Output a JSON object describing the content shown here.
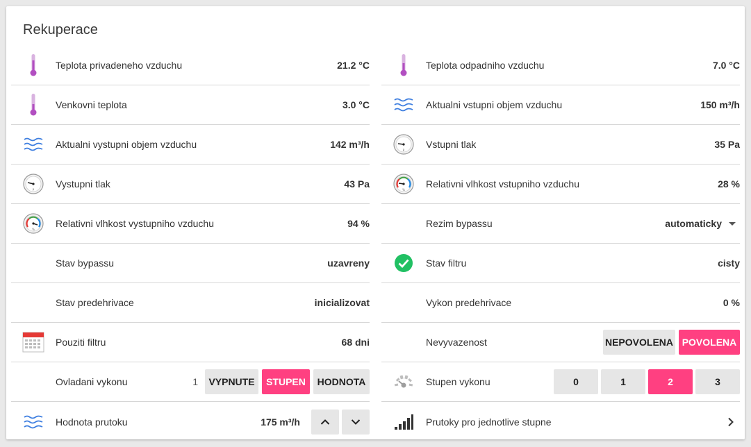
{
  "card": {
    "title": "Rekuperace"
  },
  "left": {
    "rows": [
      {
        "label": "Teplota privadeneho vzduchu",
        "value": "21.2 °C",
        "icon": "thermometer-icon"
      },
      {
        "label": "Venkovni teplota",
        "value": "3.0 °C",
        "icon": "thermometer-icon"
      },
      {
        "label": "Aktualni vystupni objem vzduchu",
        "value": "142 m³/h",
        "icon": "airflow-waves-icon"
      },
      {
        "label": "Vystupni tlak",
        "value": "43 Pa",
        "icon": "pressure-gauge-icon"
      },
      {
        "label": "Relativni vlhkost vystupniho vzduchu",
        "value": "94 %",
        "icon": "humidity-gauge-icon"
      },
      {
        "label": "Stav bypassu",
        "value": "uzavreny"
      },
      {
        "label": "Stav predehrivace",
        "value": "inicializovat"
      },
      {
        "label": "Pouziti filtru",
        "value": "68 dni",
        "icon": "calendar-icon"
      }
    ],
    "control": {
      "label": "Ovladani vykonu",
      "value": "1",
      "buttons": [
        "VYPNUTE",
        "STUPEN",
        "HODNOTA"
      ],
      "active": "STUPEN"
    },
    "flow": {
      "label": "Hodnota prutoku",
      "value": "175 m³/h",
      "icon": "airflow-waves-icon"
    }
  },
  "right": {
    "rows": [
      {
        "label": "Teplota odpadniho vzduchu",
        "value": "7.0 °C",
        "icon": "thermometer-icon"
      },
      {
        "label": "Aktualni vstupni objem vzduchu",
        "value": "150 m³/h",
        "icon": "airflow-waves-icon"
      },
      {
        "label": "Vstupni tlak",
        "value": "35 Pa",
        "icon": "pressure-gauge-icon"
      },
      {
        "label": "Relativni vlhkost vstupniho vzduchu",
        "value": "28 %",
        "icon": "humidity-gauge-icon"
      }
    ],
    "bypass_mode": {
      "label": "Rezim bypassu",
      "value": "automaticky"
    },
    "filter_state": {
      "label": "Stav filtru",
      "value": "cisty",
      "icon": "check-circle-icon"
    },
    "preheater_power": {
      "label": "Vykon predehrivace",
      "value": "0 %"
    },
    "imbalance": {
      "label": "Nevyvazenost",
      "buttons": [
        "NEPOVOLENA",
        "POVOLENA"
      ],
      "active": "POVOLENA"
    },
    "power_level": {
      "label": "Stupen vykonu",
      "icon": "speed-gauge-icon",
      "buttons": [
        "0",
        "1",
        "2",
        "3"
      ],
      "active": "2"
    },
    "flows_link": {
      "label": "Prutoky pro jednotlive stupne",
      "icon": "signal-bars-icon"
    }
  },
  "colors": {
    "accent": "#ff4081",
    "thermometer": "#b24fc1",
    "waves": "#3f7fe0",
    "check": "#21c063"
  }
}
